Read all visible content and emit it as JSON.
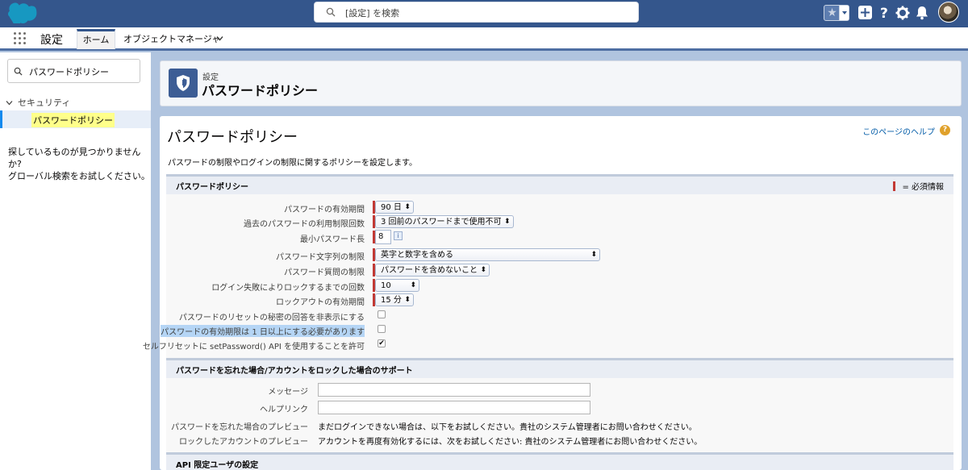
{
  "header": {
    "search_placeholder": "[設定] を検索"
  },
  "context": {
    "app_name": "設定",
    "tabs": [
      {
        "label": "ホーム"
      },
      {
        "label": "オブジェクトマネージャ"
      }
    ]
  },
  "sidebar": {
    "search_value": "パスワードポリシー",
    "parent_label": "セキュリティ",
    "child_label": "パスワードポリシー",
    "note_line1": "探しているものが見つかりませんか?",
    "note_line2": "グローバル検索をお試しください。"
  },
  "page_header": {
    "breadcrumb": "設定",
    "title": "パスワードポリシー"
  },
  "main": {
    "title": "パスワードポリシー",
    "help_link": "このページのヘルプ",
    "description": "パスワードの制限やログインの制限に関するポリシーを設定します。",
    "section1": {
      "title": "パスワードポリシー",
      "required_legend": "= 必須情報",
      "fields": [
        {
          "label": "パスワードの有効期間",
          "value": "90 日"
        },
        {
          "label": "過去のパスワードの利用制限回数",
          "value": "3 回前のパスワードまで使用不可"
        },
        {
          "label": "最小パスワード長",
          "value": "8"
        },
        {
          "label": "パスワード文字列の制限",
          "value": "英字と数字を含める"
        },
        {
          "label": "パスワード質問の制限",
          "value": "パスワードを含めないこと"
        },
        {
          "label": "ログイン失敗によりロックするまでの回数",
          "value": "10"
        },
        {
          "label": "ロックアウトの有効期間",
          "value": "15 分"
        }
      ],
      "checkboxes": [
        {
          "label": "パスワードのリセットの秘密の回答を非表示にする",
          "checked": false
        },
        {
          "label": "パスワードの有効期限は 1 日以上にする必要があります",
          "checked": false
        },
        {
          "label": "セルフリセットに setPassword() API を使用することを許可",
          "checked": true
        }
      ]
    },
    "section2": {
      "title": "パスワードを忘れた場合/アカウントをロックした場合のサポート",
      "message_label": "メッセージ",
      "helplink_label": "ヘルプリンク",
      "forgot_preview_label": "パスワードを忘れた場合のプレビュー",
      "forgot_preview_text": "まだログインできない場合は、以下をお試しください。貴社のシステム管理者にお問い合わせください。",
      "locked_preview_label": "ロックしたアカウントのプレビュー",
      "locked_preview_text": "アカウントを再度有効化するには、次をお試しください: 貴社のシステム管理者にお問い合わせください。"
    },
    "section3": {
      "title": "API 限定ユーザの設定"
    }
  },
  "colors": {
    "header_bg": "#34568c",
    "required": "#c23934",
    "link": "#015ba7"
  }
}
